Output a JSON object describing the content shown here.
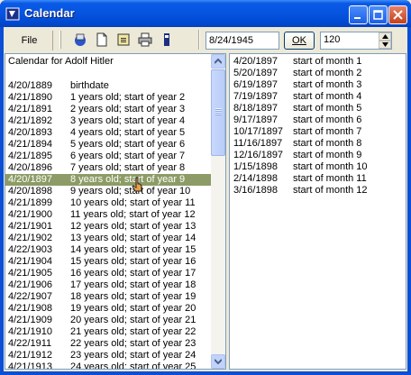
{
  "window": {
    "title": "Calendar"
  },
  "toolbar": {
    "file_label": "File",
    "tools": [
      {
        "icon": "calendar-app-icon"
      },
      {
        "icon": "new-document-icon"
      },
      {
        "icon": "save-icon"
      },
      {
        "icon": "print-icon"
      },
      {
        "icon": "info-icon"
      }
    ],
    "date_value": "8/24/1945",
    "ok_label": "OK",
    "count_value": "120"
  },
  "left_list": {
    "heading": "Calendar for Adolf Hitler",
    "rows": [
      {
        "date": "4/20/1889",
        "text": "birthdate"
      },
      {
        "date": "4/21/1890",
        "text": "1 years old; start of year 2"
      },
      {
        "date": "4/21/1891",
        "text": "2 years old; start of year 3"
      },
      {
        "date": "4/21/1892",
        "text": "3 years old; start of year 4"
      },
      {
        "date": "4/20/1893",
        "text": "4 years old; start of year 5"
      },
      {
        "date": "4/21/1894",
        "text": "5 years old; start of year 6"
      },
      {
        "date": "4/21/1895",
        "text": "6 years old; start of year 7"
      },
      {
        "date": "4/20/1896",
        "text": "7 years old; start of year 8"
      },
      {
        "date": "4/20/1897",
        "text": "8 years old; start of year 9",
        "selected": true
      },
      {
        "date": "4/20/1898",
        "text": "9 years old; start of year 10"
      },
      {
        "date": "4/21/1899",
        "text": "10 years old; start of year 11"
      },
      {
        "date": "4/21/1900",
        "text": "11 years old; start of year 12"
      },
      {
        "date": "4/21/1901",
        "text": "12 years old; start of year 13"
      },
      {
        "date": "4/21/1902",
        "text": "13 years old; start of year 14"
      },
      {
        "date": "4/22/1903",
        "text": "14 years old; start of year 15"
      },
      {
        "date": "4/21/1904",
        "text": "15 years old; start of year 16"
      },
      {
        "date": "4/21/1905",
        "text": "16 years old; start of year 17"
      },
      {
        "date": "4/21/1906",
        "text": "17 years old; start of year 18"
      },
      {
        "date": "4/22/1907",
        "text": "18 years old; start of year 19"
      },
      {
        "date": "4/21/1908",
        "text": "19 years old; start of year 20"
      },
      {
        "date": "4/21/1909",
        "text": "20 years old; start of year 21"
      },
      {
        "date": "4/21/1910",
        "text": "21 years old; start of year 22"
      },
      {
        "date": "4/22/1911",
        "text": "22 years old; start of year 23"
      },
      {
        "date": "4/21/1912",
        "text": "23 years old; start of year 24"
      },
      {
        "date": "4/21/1913",
        "text": "24 years old; start of year 25"
      }
    ]
  },
  "right_list": {
    "rows": [
      {
        "date": "4/20/1897",
        "text": "start of month 1"
      },
      {
        "date": "5/20/1897",
        "text": "start of month 2"
      },
      {
        "date": "6/19/1897",
        "text": "start of month 3"
      },
      {
        "date": "7/19/1897",
        "text": "start of month 4"
      },
      {
        "date": "8/18/1897",
        "text": "start of month 5"
      },
      {
        "date": "9/17/1897",
        "text": "start of month 6"
      },
      {
        "date": "10/17/1897",
        "text": "start of month 7"
      },
      {
        "date": "11/16/1897",
        "text": "start of month 8"
      },
      {
        "date": "12/16/1897",
        "text": "start of month 9"
      },
      {
        "date": "1/15/1898",
        "text": "start of month 10"
      },
      {
        "date": "2/14/1898",
        "text": "start of month 11"
      },
      {
        "date": "3/16/1898",
        "text": "start of month 12"
      }
    ]
  },
  "colors": {
    "title_bar": "#0654df",
    "selection": "#8d9c66",
    "window_bg": "#ece9d8"
  }
}
